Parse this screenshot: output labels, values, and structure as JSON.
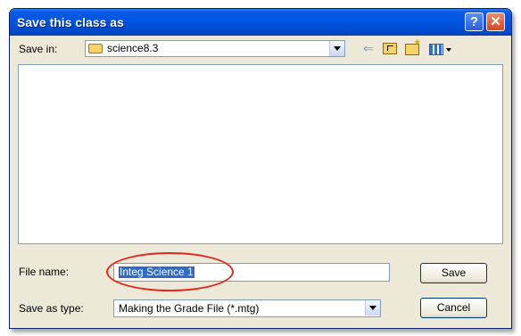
{
  "window": {
    "title": "Save this class as",
    "help_glyph": "?",
    "close_glyph": "✕"
  },
  "toolbar": {
    "save_in_label": "Save in:",
    "save_in_value": "science8.3",
    "icons": [
      "folder-icon",
      "back-arrow-icon",
      "up-one-level-icon",
      "new-folder-icon",
      "views-menu-icon"
    ]
  },
  "form": {
    "file_name_label": "File name:",
    "file_name_value": "Integ Science 1",
    "save_as_type_label": "Save as type:",
    "save_as_type_value": "Making the Grade File (*.mtg)"
  },
  "buttons": {
    "save": "Save",
    "cancel": "Cancel"
  },
  "colors": {
    "titlebar": "#0053e1",
    "dialog_bg": "#ece9d8",
    "selection": "#316ac5",
    "annotation_circle": "#e0291e"
  }
}
